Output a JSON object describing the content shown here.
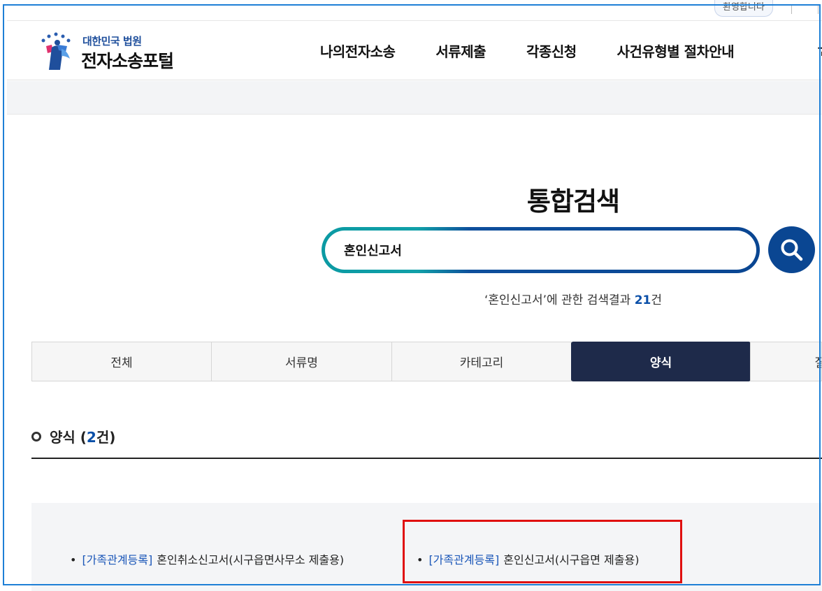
{
  "topbar": {
    "welcome": "환영합니다"
  },
  "logo": {
    "sub": "대한민국 법원",
    "main": "전자소송포털"
  },
  "nav": {
    "items": [
      "나의전자소송",
      "서류제출",
      "각종신청",
      "사건유형별 절차안내"
    ],
    "more": "고"
  },
  "search": {
    "title": "통합검색",
    "query": "혼인신고서",
    "result_prefix": "‘혼인신고서’에 관한 검색결과 ",
    "result_count": "21",
    "result_suffix": "건",
    "button_icon": "search-icon"
  },
  "tabs": [
    {
      "label": "전체",
      "active": false
    },
    {
      "label": "서류명",
      "active": false
    },
    {
      "label": "카테고리",
      "active": false
    },
    {
      "label": "양식",
      "active": true
    },
    {
      "label": "질",
      "active": false
    }
  ],
  "section": {
    "title_prefix": "양식 (",
    "count": "2",
    "title_suffix": "건)"
  },
  "results": [
    {
      "category": "[가족관계등록]",
      "title": "혼인취소신고서(시구읍면사무소 제출용)"
    },
    {
      "category": "[가족관계등록]",
      "title": "혼인신고서(시구읍면 제출용)"
    }
  ],
  "colors": {
    "accent": "#0a4692",
    "teal": "#0b9aa3",
    "active_tab": "#1e2a4a",
    "highlight": "#e01010",
    "frame": "#1e7fd6"
  }
}
